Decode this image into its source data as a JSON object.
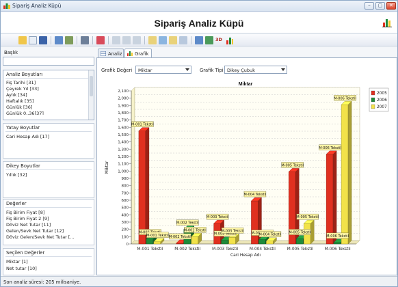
{
  "window": {
    "title": "Sipariş Analiz Küpü"
  },
  "header": {
    "title": "Sipariş Analiz Küpü"
  },
  "toolbar": {
    "label_3d": "3D"
  },
  "left": {
    "baslik_label": "Başlık",
    "baslik_value": "",
    "analiz_label": "Analiz Boyutları",
    "analiz_items": [
      "Fiş Tarihi [31]",
      "Çeyrek Yıl [33]",
      "Aylık [34]",
      "Haftalık [35]",
      "Günlük [36]",
      "Günlük 0..36[37]"
    ],
    "yatay_label": "Yatay Boyutlar",
    "yatay_items": [
      "Cari Hesap Adı [17]"
    ],
    "dikey_label": "Dikey Boyutlar",
    "dikey_items": [
      "Yıllık [32]"
    ],
    "degerler_label": "Değerler",
    "degerler_items": [
      "Fiş Birim Fiyat [8]",
      "Fiş Birim Fiyat 2 [9]",
      "Döviz Net Tutar [11]",
      "Gelen/Sevk Net Tutar [12]",
      "Döviz Gelen/Sevk Net Tutar [..."
    ],
    "secilen_label": "Seçilen Değerler",
    "secilen_items": [
      "Miktar [1]",
      "Net tutar [10]"
    ]
  },
  "tabs": [
    {
      "label": "Analiz"
    },
    {
      "label": "Grafik"
    }
  ],
  "controls": {
    "grafik_degeri_label": "Grafik Değeri",
    "grafik_degeri_value": "Miktar",
    "grafik_tipi_label": "Grafik Tipi",
    "grafik_tipi_value": "Dikey Çubuk"
  },
  "status": {
    "text": "Son analiz süresi: 205 milisaniye."
  },
  "colors": {
    "red": "#e03020",
    "green": "#1f8a3a",
    "yellow": "#f2e24a"
  },
  "chart_data": {
    "type": "bar",
    "title": "Miktar",
    "xlabel": "Cari Hesap Adı",
    "ylabel": "Miktar",
    "categories": [
      "M-001 Tekstil",
      "M-002 Tekstil",
      "M-003 Tekstil",
      "M-004 Tekstil",
      "M-005 Tekstil",
      "M-006 Tekstil"
    ],
    "series": [
      {
        "name": "2005",
        "color": "#e03020",
        "values": [
          1550,
          10,
          280,
          590,
          990,
          1230
        ]
      },
      {
        "name": "2006",
        "color": "#1f8a3a",
        "values": [
          70,
          200,
          50,
          60,
          70,
          20
        ]
      },
      {
        "name": "2007",
        "color": "#f2e24a",
        "values": [
          30,
          100,
          90,
          40,
          280,
          1910
        ]
      }
    ],
    "point_labels": [
      "M-001 Tekstil",
      "M-001 Tekstil",
      "M-001 Tekstil",
      "M-002 Tekstil",
      "M-002 Tekstil",
      "M-002 Tekstil",
      "M-003 Tekstil",
      "M-003 Tekstil",
      "M-003 Tekstil",
      "M-004 Tekstil",
      "M-004 Tekstil",
      "M-004 Tekstil",
      "M-005 Tekstil",
      "M-005 Tekstil",
      "M-005 Tekstil",
      "M-006 Tekstil",
      "M-006 Tekstil",
      "M-006 Tekstil"
    ],
    "yticks": [
      "0",
      "100",
      "200",
      "300",
      "400",
      "500",
      "600",
      "700",
      "800",
      "900",
      "1,000",
      "1,100",
      "1,200",
      "1,300",
      "1,400",
      "1,500",
      "1,600",
      "1,700",
      "1,800",
      "1,900",
      "2,000",
      "2,100"
    ],
    "ylim": [
      0,
      2100
    ],
    "grid": true,
    "legend": "top-right"
  }
}
